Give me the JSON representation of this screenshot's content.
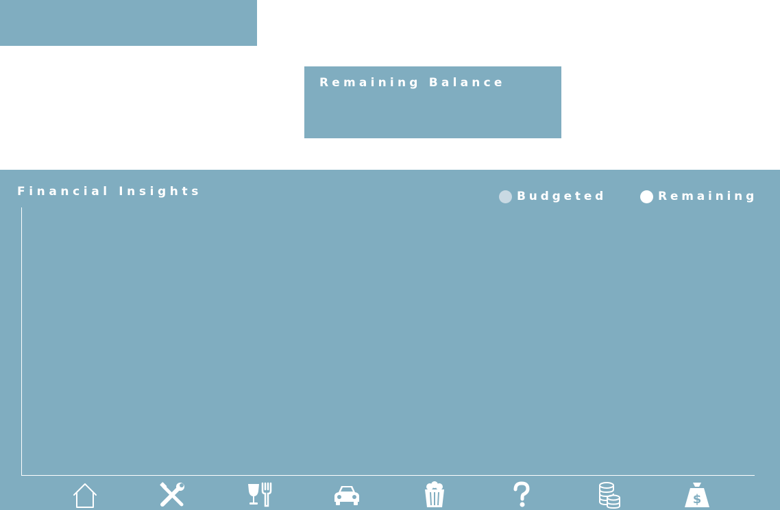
{
  "balance_card": {
    "title": "Remaining Balance"
  },
  "insights": {
    "title": "Financial Insights",
    "legend": [
      {
        "label": "Budgeted",
        "color": "#c9d9e3"
      },
      {
        "label": "Remaining",
        "color": "#ffffff"
      }
    ]
  },
  "chart_data": {
    "type": "bar",
    "categories": [
      "home",
      "tools",
      "dining",
      "car",
      "popcorn",
      "misc",
      "coins",
      "money-bag"
    ],
    "series": [
      {
        "name": "Budgeted",
        "values": []
      },
      {
        "name": "Remaining",
        "values": []
      }
    ],
    "grid": false,
    "legend_position": "top-right"
  },
  "category_icons": [
    "home-icon",
    "tools-icon",
    "dining-icon",
    "car-icon",
    "popcorn-icon",
    "question-mark-icon",
    "coins-icon",
    "money-bag-icon"
  ],
  "colors": {
    "panel": "#80adc0",
    "text": "#ffffff",
    "axis": "#ffffff"
  }
}
